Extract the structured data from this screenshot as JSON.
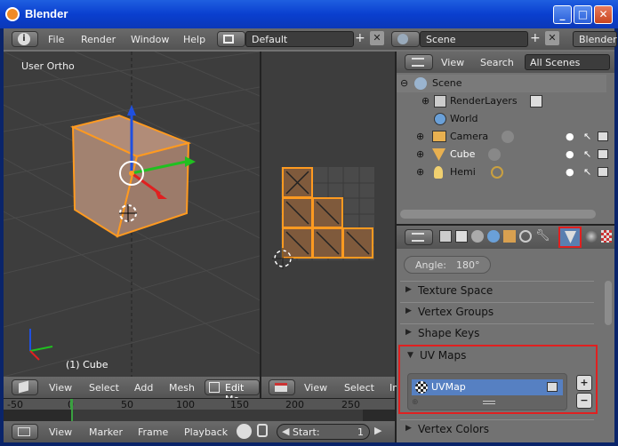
{
  "window": {
    "title": "Blender"
  },
  "topbar": {
    "menus": [
      "File",
      "Render",
      "Window",
      "Help"
    ],
    "layout": "Default",
    "scene": "Scene",
    "engine": "Blender"
  },
  "viewport3d": {
    "view_label": "User Ortho",
    "object_label": "(1) Cube",
    "header": {
      "view": "View",
      "select": "Select",
      "add": "Add",
      "mesh": "Mesh",
      "mode": "Edit Mo"
    }
  },
  "uv_editor": {
    "header": {
      "view": "View",
      "select": "Select",
      "image": "Ima"
    }
  },
  "outliner": {
    "header": {
      "view": "View",
      "search": "Search",
      "filter": "All Scenes"
    },
    "items": [
      {
        "label": "Scene"
      },
      {
        "label": "RenderLayers"
      },
      {
        "label": "World"
      },
      {
        "label": "Camera"
      },
      {
        "label": "Cube"
      },
      {
        "label": "Hemi"
      }
    ]
  },
  "properties": {
    "angle_label": "Angle:",
    "angle_value": "180°",
    "panels": [
      "Texture Space",
      "Vertex Groups",
      "Shape Keys",
      "UV Maps",
      "Vertex Colors"
    ],
    "uv_map_name": "UVMap"
  },
  "timeline": {
    "ticks": [
      "-50",
      "0",
      "50",
      "100",
      "150",
      "200",
      "250"
    ],
    "header": {
      "view": "View",
      "marker": "Marker",
      "frame": "Frame",
      "playback": "Playback"
    },
    "start_label": "Start:",
    "start_value": "1"
  },
  "colors": {
    "highlight": "#e02020",
    "selection": "#ff9a20",
    "uv_selected": "#5680c2"
  }
}
